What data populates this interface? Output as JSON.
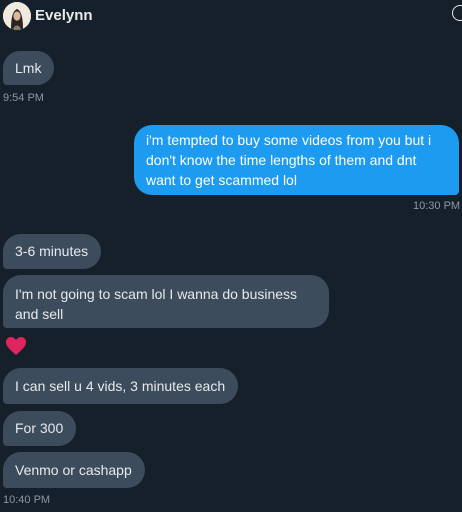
{
  "header": {
    "name": "Evelynn",
    "avatar_icon": "avatar-icon",
    "info_icon": "info-icon"
  },
  "messages": [
    {
      "id": "m1",
      "direction": "received",
      "text": "Lmk"
    },
    {
      "id": "t1",
      "timestamp": "9:54 PM"
    },
    {
      "id": "m2",
      "direction": "sent",
      "text": "i'm tempted to buy some videos from you but i don't know the time lengths of them and dnt want to get scammed lol"
    },
    {
      "id": "t2",
      "timestamp": "10:30 PM"
    },
    {
      "id": "m3",
      "direction": "received",
      "text": "3-6 minutes"
    },
    {
      "id": "m4",
      "direction": "received",
      "text": "I'm not going to scam lol I wanna do business and sell"
    },
    {
      "id": "m5",
      "direction": "received",
      "reaction": "heart-emoji"
    },
    {
      "id": "m6",
      "direction": "received",
      "text": "I can sell u 4 vids, 3 minutes each"
    },
    {
      "id": "m7",
      "direction": "received",
      "text": "For 300"
    },
    {
      "id": "m8",
      "direction": "received",
      "text": "Venmo or cashapp"
    },
    {
      "id": "t3",
      "timestamp": "10:40 PM"
    }
  ],
  "colors": {
    "background": "#15202b",
    "incoming_bubble": "#3d4c5c",
    "outgoing_bubble": "#1d9bf0",
    "timestamp": "#8b98a5",
    "heart": "#e0245e"
  }
}
